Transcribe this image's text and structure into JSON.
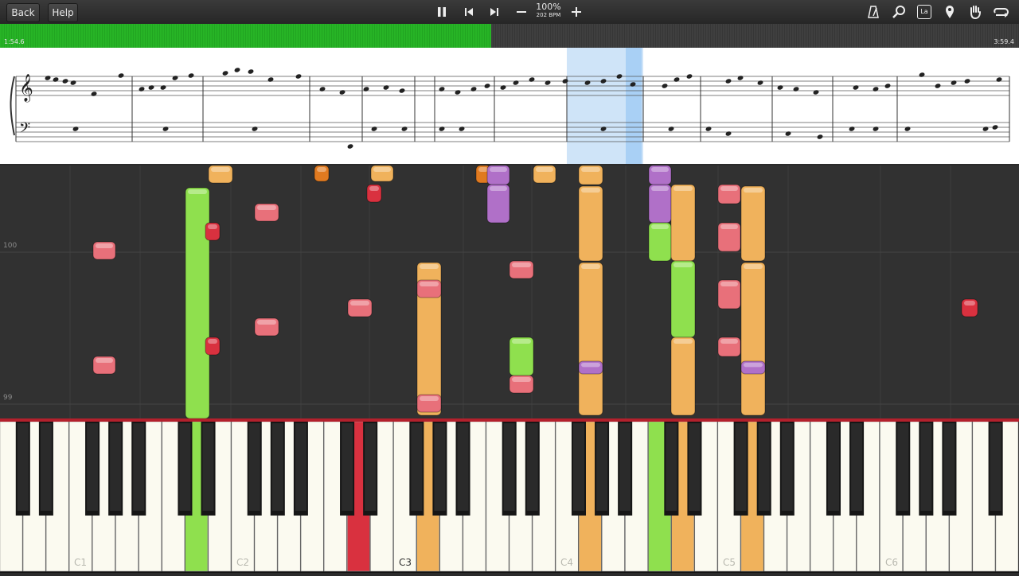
{
  "toolbar": {
    "back_label": "Back",
    "help_label": "Help",
    "speed": "100%",
    "bpm": "202 BPM",
    "icons": [
      "pause-icon",
      "skip-back-icon",
      "skip-forward-icon",
      "minus-icon",
      "plus-icon",
      "metronome-icon",
      "search-icon",
      "note-label-icon",
      "marker-icon",
      "hand-icon",
      "loop-icon"
    ],
    "note_label_glyph": "La"
  },
  "progress": {
    "current_time": "1:54.6",
    "total_time": "3:59.4",
    "fraction": 0.482,
    "fill_color": "#27b426"
  },
  "roll": {
    "measure_labels": [
      "100",
      "99"
    ],
    "note_colors": {
      "green": "#8fe04e",
      "orange": "#f0b25c",
      "pink": "#e8707a",
      "red": "#d9313f",
      "purple": "#b070c8",
      "dark_orange": "#e07a20"
    }
  },
  "keyboard": {
    "octave_labels": [
      "C1",
      "C2",
      "C3",
      "C4",
      "C5",
      "C6"
    ],
    "highlighted_octave": "C3"
  }
}
